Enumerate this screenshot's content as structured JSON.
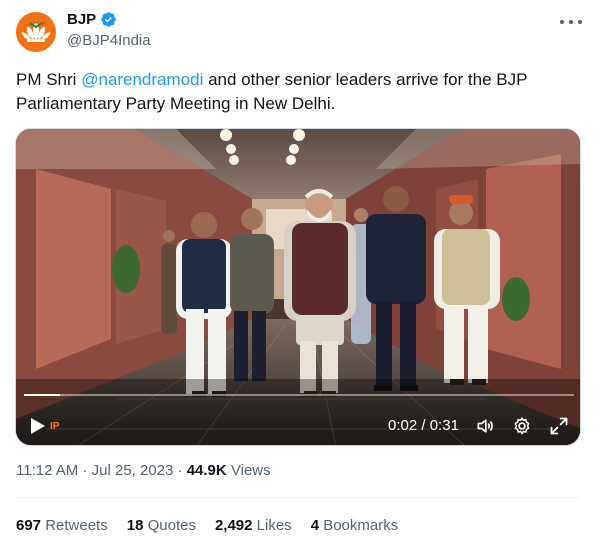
{
  "author": {
    "display_name": "BJP",
    "handle": "@BJP4India",
    "verified": true
  },
  "tweet": {
    "text_before": "PM Shri ",
    "mention": "@narendramodi",
    "text_after": " and other senior leaders arrive for the BJP Parliamentary Party Meeting in New Delhi."
  },
  "video": {
    "current_time": "0:02",
    "separator": " / ",
    "duration": "0:31",
    "progress_fraction": 0.065,
    "logo_text": "IP"
  },
  "meta": {
    "time": "11:12 AM",
    "sep1": " · ",
    "date": "Jul 25, 2023",
    "sep2": " · ",
    "views_count": "44.9K",
    "views_label": " Views"
  },
  "stats": {
    "retweets_count": "697",
    "retweets_label": " Retweets",
    "quotes_count": "18",
    "quotes_label": " Quotes",
    "likes_count": "2,492",
    "likes_label": " Likes",
    "bookmarks_count": "4",
    "bookmarks_label": " Bookmarks"
  },
  "colors": {
    "accent": "#1d9bf0",
    "brand": "#f47216",
    "muted": "#536471"
  },
  "icons": [
    "bjp-lotus-avatar",
    "verified-badge-icon",
    "more-options-icon",
    "play-icon",
    "volume-icon",
    "settings-gear-icon",
    "fullscreen-icon"
  ]
}
